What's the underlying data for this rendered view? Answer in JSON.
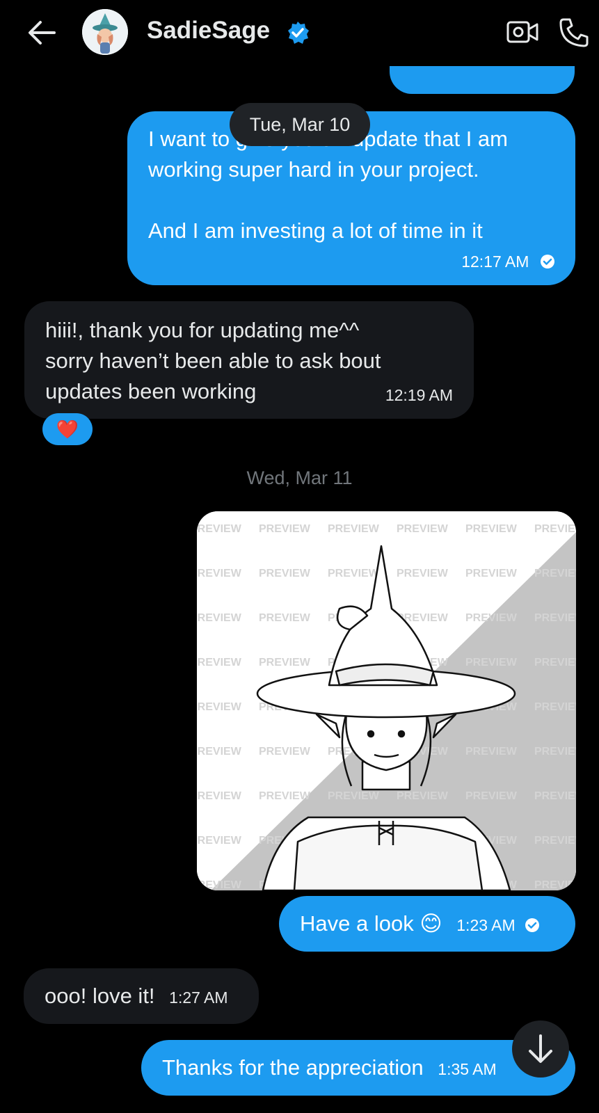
{
  "header": {
    "username": "SadieSage"
  },
  "date_separators": {
    "first": "Tue, Mar 10",
    "second": "Wed, Mar 11"
  },
  "messages": [
    {
      "line1": "I want to give you an update that I am",
      "line2": "working super hard in your project.",
      "line3": "And I am investing a lot of time in it",
      "time": "12:17 AM"
    },
    {
      "line1": "hiii!, thank you for updating me^^",
      "line2": "sorry haven’t been able to ask bout",
      "line3": "updates been working",
      "time": "12:19 AM",
      "reaction": "❤️"
    },
    {
      "text": "Have a look 😊",
      "time": "1:23 AM"
    },
    {
      "text": "ooo! love it!",
      "time": "1:27 AM"
    },
    {
      "text": "Thanks for the appreciation",
      "time": "1:35 AM"
    }
  ],
  "image_watermark": "PREVIEW",
  "colors": {
    "outgoing": "#1d9bf0",
    "incoming": "#16181c",
    "background": "#000000"
  }
}
